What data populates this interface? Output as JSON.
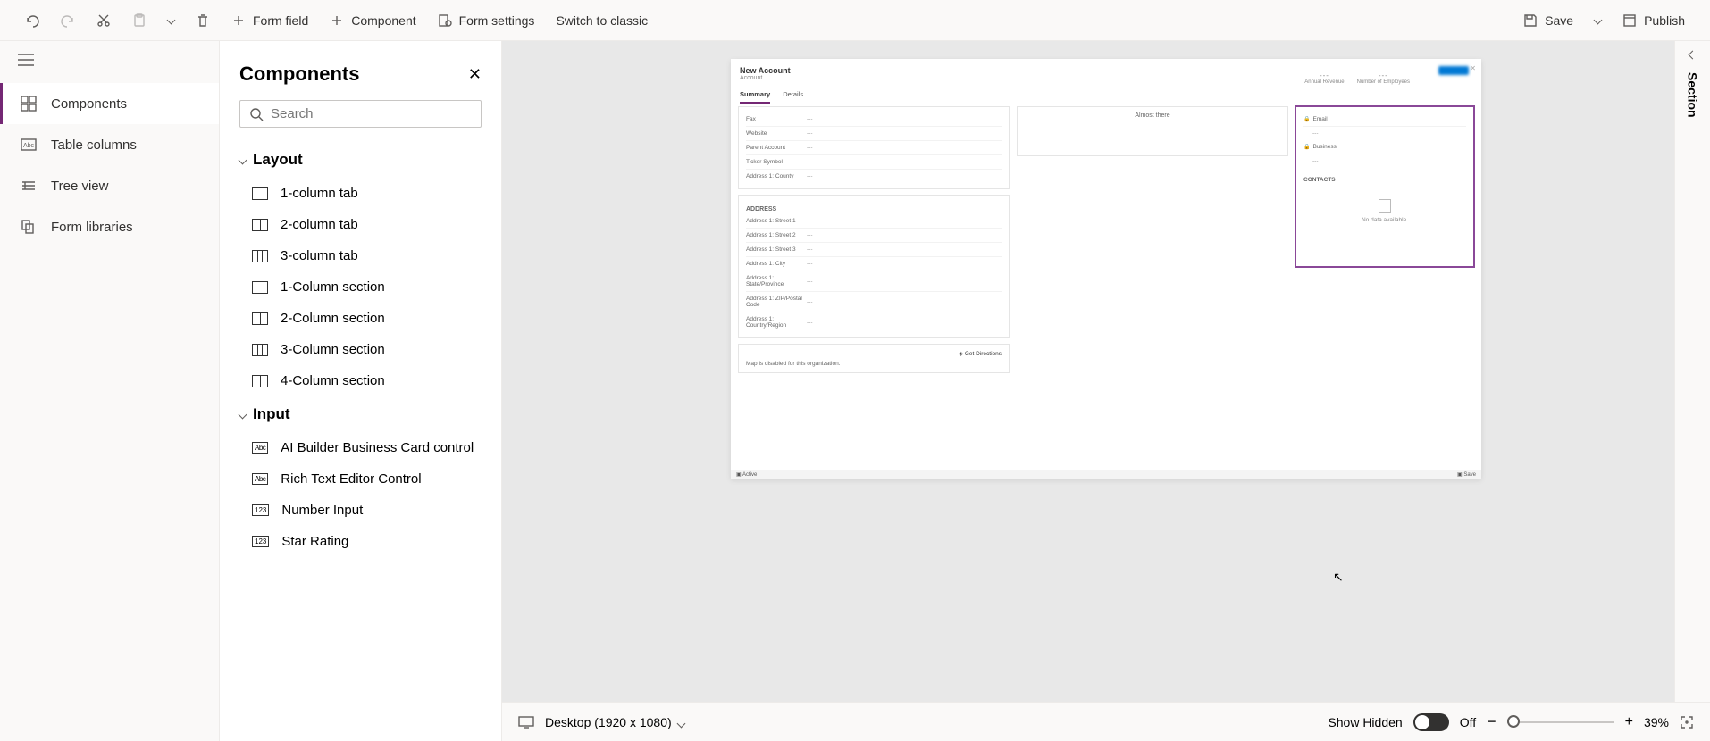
{
  "toolbar": {
    "undo": "Undo",
    "redo": "Redo",
    "cut": "Cut",
    "paste": "Paste",
    "delete": "Delete",
    "form_field": "Form field",
    "component": "Component",
    "form_settings": "Form settings",
    "switch_classic": "Switch to classic",
    "save": "Save",
    "publish": "Publish"
  },
  "left_rail": {
    "components": "Components",
    "table_columns": "Table columns",
    "tree_view": "Tree view",
    "form_libraries": "Form libraries"
  },
  "components_panel": {
    "title": "Components",
    "search_placeholder": "Search",
    "groups": {
      "layout": {
        "label": "Layout",
        "items": [
          "1-column tab",
          "2-column tab",
          "3-column tab",
          "1-Column section",
          "2-Column section",
          "3-Column section",
          "4-Column section"
        ]
      },
      "input": {
        "label": "Input",
        "items": [
          "AI Builder Business Card control",
          "Rich Text Editor Control",
          "Number Input",
          "Star Rating"
        ]
      }
    }
  },
  "form_preview": {
    "title": "New Account",
    "subtitle": "Account",
    "header_fields": {
      "annual_revenue": "Annual Revenue",
      "employees": "Number of Employees"
    },
    "tabs": {
      "summary": "Summary",
      "details": "Details"
    },
    "top_fields": [
      {
        "label": "Fax",
        "value": "---"
      },
      {
        "label": "Website",
        "value": "---"
      },
      {
        "label": "Parent Account",
        "value": "---"
      },
      {
        "label": "Ticker Symbol",
        "value": "---"
      },
      {
        "label": "Address 1: County",
        "value": "---"
      }
    ],
    "address_section_title": "ADDRESS",
    "address_fields": [
      {
        "label": "Address 1: Street 1",
        "value": "---"
      },
      {
        "label": "Address 1: Street 2",
        "value": "---"
      },
      {
        "label": "Address 1: Street 3",
        "value": "---"
      },
      {
        "label": "Address 1: City",
        "value": "---"
      },
      {
        "label": "Address 1: State/Province",
        "value": "---"
      },
      {
        "label": "Address 1: ZIP/Postal Code",
        "value": "---"
      },
      {
        "label": "Address 1: Country/Region",
        "value": "---"
      }
    ],
    "get_directions": "Get Directions",
    "map_disabled": "Map is disabled for this organization.",
    "almost_there": "Almost there",
    "right_panel": {
      "email": "Email",
      "business": "Business",
      "contacts_title": "CONTACTS",
      "no_data": "No data available."
    },
    "footer": {
      "status": "Active",
      "save": "Save"
    }
  },
  "bottom_bar": {
    "device": "Desktop (1920 x 1080)",
    "show_hidden": "Show Hidden",
    "toggle_state": "Off",
    "zoom": "39%"
  },
  "right_panel": {
    "label": "Section"
  }
}
